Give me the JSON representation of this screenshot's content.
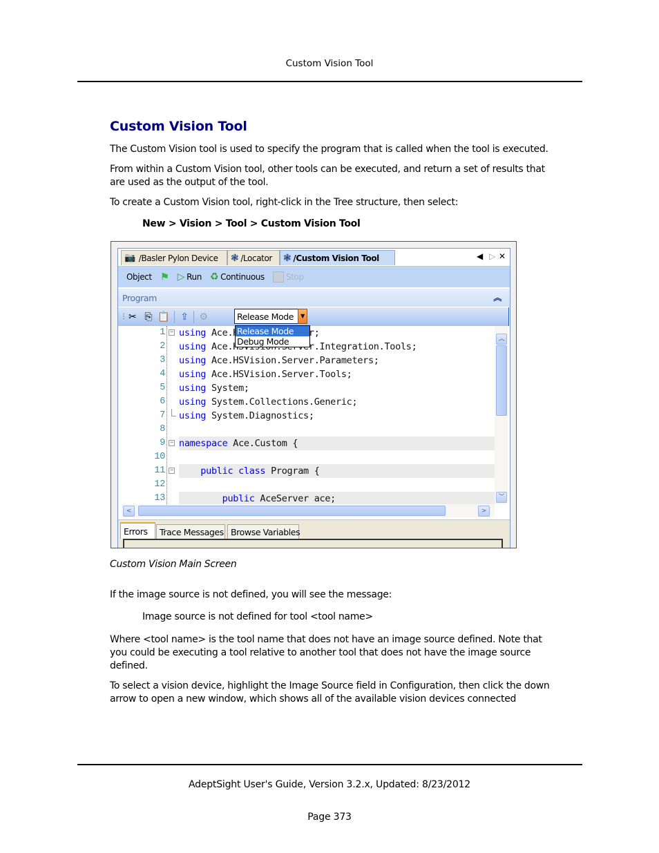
{
  "page_header": {
    "title": "Custom Vision Tool"
  },
  "section": {
    "heading": "Custom Vision Tool",
    "paragraphs": [
      "The Custom Vision tool is used to specify the program that is called when the tool is executed.",
      "From within a Custom Vision tool, other tools can be executed, and return a set of results that are used as the output of the tool.",
      "To create a Custom Vision tool, right-click in the Tree structure, then select:"
    ],
    "menu_path": "New > Vision > Tool > Custom Vision Tool",
    "figure_caption": "Custom Vision Main Screen",
    "paragraphs_after": [
      "If the image source is not defined, you will see the message:",
      "Image source is not defined for tool <tool name>",
      "Where <tool name> is the tool name that does not have an image source defined. Note that you could be executing a tool relative to another tool that does not have the image source defined.",
      "To select a vision device, highlight the Image Source field in Configuration, then click the down arrow to open a new window, which shows all of the available vision devices connected"
    ]
  },
  "screenshot": {
    "doc_tabs": [
      {
        "label": "/Basler Pylon Device",
        "icon": "camera-icon",
        "active": false
      },
      {
        "label": "/Locator",
        "icon": "aperture-icon",
        "active": false
      },
      {
        "label": "/Custom Vision Tool",
        "icon": "aperture-icon",
        "active": true
      }
    ],
    "tab_controls": {
      "prev": "◀",
      "next": "▷",
      "close": "✕"
    },
    "command_bar": {
      "object_label": "Object",
      "run_label": "Run",
      "continuous_label": "Continuous",
      "stop_label": "Stop"
    },
    "program_panel": {
      "title": "Program",
      "collapse_glyph": "⌃"
    },
    "toolbar": {
      "mode_selected": "Release Mode",
      "mode_options": [
        "Release Mode",
        "Debug Mode"
      ],
      "highlighted_option": "Release Mode"
    },
    "code_lines": [
      {
        "n": "1",
        "kw": "using",
        "rest": " Ace.HSVision.Server;",
        "fold": "minus",
        "shade": false
      },
      {
        "n": "2",
        "kw": "using",
        "rest": " Ace.HSVision.Server.Integration.Tools;",
        "fold": "",
        "shade": false
      },
      {
        "n": "3",
        "kw": "using",
        "rest": " Ace.HSVision.Server.Parameters;",
        "fold": "",
        "shade": false
      },
      {
        "n": "4",
        "kw": "using",
        "rest": " Ace.HSVision.Server.Tools;",
        "fold": "",
        "shade": false
      },
      {
        "n": "5",
        "kw": "using",
        "rest": " System;",
        "fold": "",
        "shade": false
      },
      {
        "n": "6",
        "kw": "using",
        "rest": " System.Collections.Generic;",
        "fold": "",
        "shade": false
      },
      {
        "n": "7",
        "kw": "using",
        "rest": " System.Diagnostics;",
        "fold": "end",
        "shade": false
      },
      {
        "n": "8",
        "kw": "",
        "rest": "",
        "fold": "",
        "shade": false
      },
      {
        "n": "9",
        "kw": "namespace",
        "rest": " Ace.Custom {",
        "fold": "minus",
        "shade": true
      },
      {
        "n": "10",
        "kw": "",
        "rest": "",
        "fold": "",
        "shade": false
      },
      {
        "n": "11",
        "kw": "    public class",
        "rest": " Program {",
        "fold": "minus",
        "shade": true
      },
      {
        "n": "12",
        "kw": "",
        "rest": "",
        "fold": "",
        "shade": false
      },
      {
        "n": "13",
        "kw": "        public",
        "rest": " AceServer ace;",
        "fold": "",
        "shade": true
      }
    ],
    "bottom_tabs": [
      "Errors",
      "Trace Messages",
      "Browse Variables"
    ],
    "active_bottom_tab": "Errors"
  },
  "footer": {
    "guide": "AdeptSight User's Guide,  Version 3.2.x, Updated: 8/23/2012",
    "page": "Page 373"
  }
}
